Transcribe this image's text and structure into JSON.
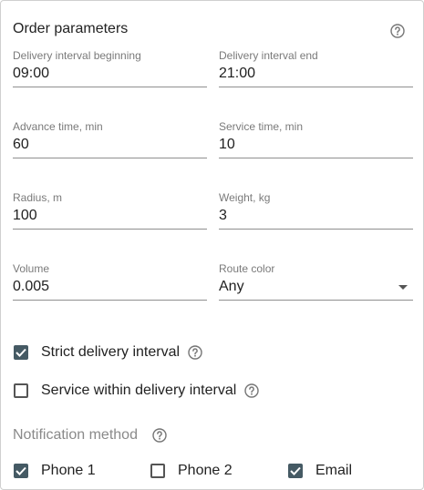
{
  "panel": {
    "title": "Order parameters"
  },
  "fields": {
    "delivery_begin": {
      "label": "Delivery interval beginning",
      "value": "09:00"
    },
    "delivery_end": {
      "label": "Delivery interval end",
      "value": "21:00"
    },
    "advance_time": {
      "label": "Advance time, min",
      "value": "60"
    },
    "service_time": {
      "label": "Service time, min",
      "value": "10"
    },
    "radius": {
      "label": "Radius, m",
      "value": "100"
    },
    "weight": {
      "label": "Weight, kg",
      "value": "3"
    },
    "volume": {
      "label": "Volume",
      "value": "0.005"
    },
    "route_color": {
      "label": "Route color",
      "value": "Any"
    }
  },
  "checkboxes": {
    "strict_interval": {
      "label": "Strict delivery interval",
      "checked": true
    },
    "service_within": {
      "label": "Service within delivery interval",
      "checked": false
    }
  },
  "notification": {
    "label": "Notification method",
    "options": [
      {
        "label": "Phone 1",
        "checked": true
      },
      {
        "label": "Phone 2",
        "checked": false
      },
      {
        "label": "Email",
        "checked": true
      }
    ]
  },
  "colors": {
    "checkbox_checked": "#455a64",
    "underline": "#8f8f8f",
    "label": "#7a7a7a"
  },
  "icons": [
    "help-circle-icon",
    "dropdown-caret-icon",
    "checkmark-icon"
  ]
}
